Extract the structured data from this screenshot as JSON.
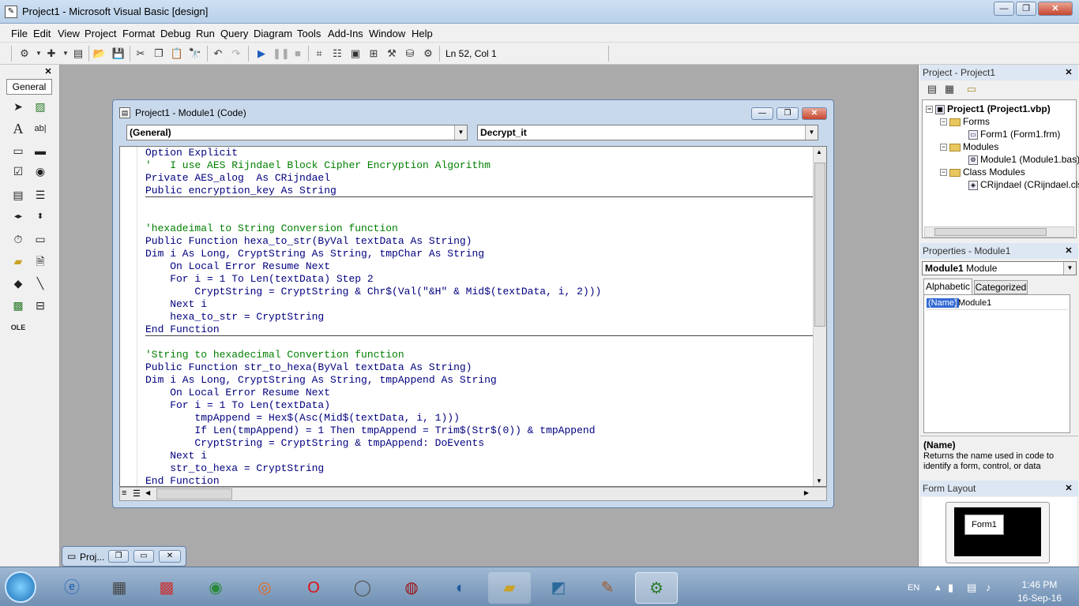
{
  "window": {
    "title": "Project1 - Microsoft Visual Basic [design]",
    "min_label": "—",
    "max_label": "❐",
    "close_label": "✕"
  },
  "menu": [
    "File",
    "Edit",
    "View",
    "Project",
    "Format",
    "Debug",
    "Run",
    "Query",
    "Diagram",
    "Tools",
    "Add-Ins",
    "Window",
    "Help"
  ],
  "toolbar": {
    "status": "Ln 52, Col 1"
  },
  "toolbox": {
    "tab": "General",
    "close": "✕"
  },
  "code_window": {
    "title": "Project1 - Module1 (Code)",
    "object_combo": "(General)",
    "procedure_combo": "Decrypt_it",
    "lines": [
      {
        "text": "Option Explicit",
        "type": "code"
      },
      {
        "text": "'   I use AES Rijndael Block Cipher Encryption Algorithm",
        "type": "comment"
      },
      {
        "text": "Private AES_alog  As CRijndael",
        "type": "code"
      },
      {
        "text": "Public encryption_key As String",
        "type": "code",
        "rule": true
      },
      {
        "text": "",
        "type": "code"
      },
      {
        "text": "",
        "type": "code"
      },
      {
        "text": "'hexadeimal to String Conversion function",
        "type": "comment"
      },
      {
        "text": "Public Function hexa_to_str(ByVal textData As String)",
        "type": "code"
      },
      {
        "text": "Dim i As Long, CryptString As String, tmpChar As String",
        "type": "code"
      },
      {
        "text": "    On Local Error Resume Next",
        "type": "code"
      },
      {
        "text": "    For i = 1 To Len(textData) Step 2",
        "type": "code"
      },
      {
        "text": "        CryptString = CryptString & Chr$(Val(\"&H\" & Mid$(textData, i, 2)))",
        "type": "code"
      },
      {
        "text": "    Next i",
        "type": "code"
      },
      {
        "text": "    hexa_to_str = CryptString",
        "type": "code"
      },
      {
        "text": "End Function",
        "type": "code",
        "rule": true
      },
      {
        "text": "",
        "type": "code"
      },
      {
        "text": "'String to hexadecimal Convertion function",
        "type": "comment"
      },
      {
        "text": "Public Function str_to_hexa(ByVal textData As String)",
        "type": "code"
      },
      {
        "text": "Dim i As Long, CryptString As String, tmpAppend As String",
        "type": "code"
      },
      {
        "text": "    On Local Error Resume Next",
        "type": "code"
      },
      {
        "text": "    For i = 1 To Len(textData)",
        "type": "code"
      },
      {
        "text": "        tmpAppend = Hex$(Asc(Mid$(textData, i, 1)))",
        "type": "code"
      },
      {
        "text": "        If Len(tmpAppend) = 1 Then tmpAppend = Trim$(Str$(0)) & tmpAppend",
        "type": "code"
      },
      {
        "text": "        CryptString = CryptString & tmpAppend: DoEvents",
        "type": "code"
      },
      {
        "text": "    Next i",
        "type": "code"
      },
      {
        "text": "    str_to_hexa = CryptString",
        "type": "code"
      },
      {
        "text": "End Function",
        "type": "code"
      }
    ]
  },
  "minimized": {
    "label": "Proj..."
  },
  "project_explorer": {
    "title": "Project - Project1",
    "root": "Project1 (Project1.vbp)",
    "forms_folder": "Forms",
    "form1": "Form1 (Form1.frm)",
    "modules_folder": "Modules",
    "module1": "Module1 (Module1.bas)",
    "class_folder": "Class Modules",
    "class1": "CRijndael (CRijndael.cls)"
  },
  "properties": {
    "title": "Properties - Module1",
    "object": "Module1",
    "object_type": "Module",
    "tab_alpha": "Alphabetic",
    "tab_cat": "Categorized",
    "prop_name": "(Name)",
    "prop_value": "Module1",
    "desc_title": "(Name)",
    "desc_text": "Returns the name used in code to identify a form, control, or data"
  },
  "form_layout": {
    "title": "Form Layout",
    "form_label": "Form1"
  },
  "taskbar": {
    "lang": "EN",
    "time": "1:46 PM",
    "date": "16-Sep-16"
  },
  "colors": {
    "keyword": "#00007f",
    "comment": "#007f00"
  }
}
